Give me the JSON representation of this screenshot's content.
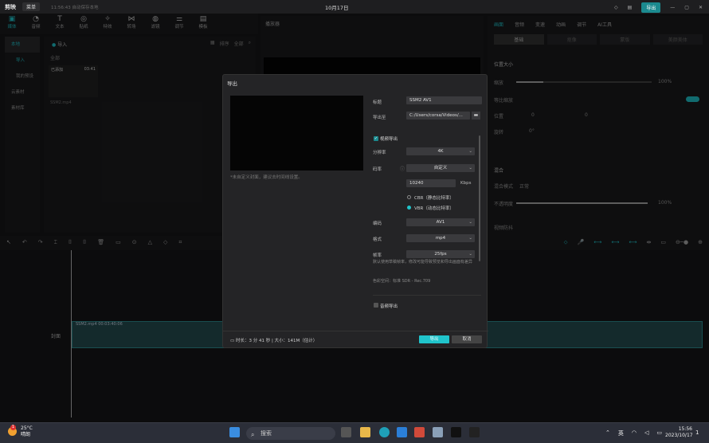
{
  "titlebar": {
    "app_name": "剪映",
    "menu_label": "菜单",
    "autosave": "11:56:43 自动保存本地",
    "date": "10月17日",
    "export_label": "导出"
  },
  "toolbar": {
    "tools": [
      {
        "label": "媒体",
        "icon": "media-icon",
        "glyph": "▣"
      },
      {
        "label": "音频",
        "icon": "audio-icon",
        "glyph": "◔"
      },
      {
        "label": "文本",
        "icon": "text-icon",
        "glyph": "T"
      },
      {
        "label": "贴纸",
        "icon": "sticker-icon",
        "glyph": "◎"
      },
      {
        "label": "特效",
        "icon": "effects-icon",
        "glyph": "✧"
      },
      {
        "label": "转场",
        "icon": "transition-icon",
        "glyph": "⋈"
      },
      {
        "label": "滤镜",
        "icon": "filter-icon",
        "glyph": "◍"
      },
      {
        "label": "调节",
        "icon": "adjust-icon",
        "glyph": "⚌"
      },
      {
        "label": "模板",
        "icon": "template-icon",
        "glyph": "▤"
      }
    ]
  },
  "left_nav": {
    "items": [
      "本地",
      "导入",
      "我的预设",
      "云素材",
      "素材库"
    ]
  },
  "media": {
    "import_label": "导入",
    "all_label": "全部",
    "sort_label": "排序",
    "filter_label": "全部",
    "clip_badge": "已添加",
    "clip_duration": "03:41",
    "clip_name": "SSM2.mp4"
  },
  "player": {
    "header": "播放器"
  },
  "right_panel": {
    "tabs": [
      "画面",
      "音频",
      "变速",
      "动画",
      "调节",
      "AI工具"
    ],
    "subtabs": [
      "基础",
      "抠像",
      "蒙版",
      "美颜美体"
    ],
    "rows": [
      {
        "label": "位置大小"
      },
      {
        "label": "缩放",
        "value": "100%"
      },
      {
        "label": "等比缩放"
      },
      {
        "label": "位置",
        "value": "0"
      },
      {
        "label": "旋转",
        "value": "0°"
      },
      {
        "label": "混合"
      },
      {
        "label": "混合模式",
        "value": "正常"
      },
      {
        "label": "不透明度",
        "value": "100%"
      },
      {
        "label": "视频防抖"
      }
    ]
  },
  "timeline": {
    "cover_label": "封面",
    "track_label": "SSM2.mp4  00:03:40:06"
  },
  "dialog": {
    "title": "导出",
    "cover_tip": "*未自定义封面，建议去时间线设置。",
    "fields": {
      "title_label": "标题",
      "title_value": "SSM2 AV1",
      "export_to_label": "导出至",
      "export_to_value": "C:/Users/corsa/Videos/...",
      "video_export_label": "视频导出",
      "resolution_label": "分辨率",
      "resolution_value": "4K",
      "bitrate_label": "码率",
      "bitrate_value": "自定义",
      "kbps_value": "10240",
      "kbps_unit": "Kbps",
      "cbr_label": "CBR（静态比特率）",
      "vbr_label": "VBR（动态比特率）",
      "codec_label": "编码",
      "codec_value": "AV1",
      "format_label": "格式",
      "format_value": "mp4",
      "fps_label": "帧率",
      "fps_value": "25fps",
      "fps_note": "默认使用草稿帧率，修改可能导致预览和导出画面有差异",
      "color_space": "色彩空间：标准 SDR - Rec.709",
      "audio_export_label": "音频导出"
    },
    "footer_info": "时长：3 分 41 秒 | 大小：141M（估计）",
    "export_button": "导出",
    "cancel_button": "取消"
  },
  "taskbar": {
    "temperature": "25°C",
    "weather": "晴朗",
    "badge": "1",
    "search_placeholder": "搜索",
    "lang": "英",
    "time": "15:56",
    "date": "2023/10/17"
  }
}
